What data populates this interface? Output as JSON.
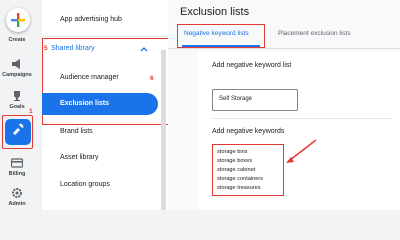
{
  "rail": {
    "create_label": "Create",
    "campaigns_label": "Campaigns",
    "goals_label": "Goals",
    "tools_label": "Tools",
    "billing_label": "Billing",
    "admin_label": "Admin"
  },
  "callouts": {
    "tools_step": "1",
    "shared_library_step": "5",
    "exclusion_lists_step": "6"
  },
  "nav": {
    "top_item": "App advertising hub",
    "shared_library": "Shared library",
    "items": [
      "Audience manager",
      "Exclusion lists",
      "Brand lists",
      "Asset library",
      "Location groups"
    ]
  },
  "page": {
    "title": "Exclusion lists",
    "tabs": [
      "Negative keyword lists",
      "Placement exclusion lists"
    ],
    "add_list_heading": "Add negative keyword list",
    "list_name_value": "Self Storage",
    "add_keywords_heading": "Add negative keywords",
    "keywords": [
      "storage bins",
      "storage boxes",
      "storage cabinet",
      "storage containers",
      "storage treasures"
    ]
  },
  "colors": {
    "accent": "#1a73e8",
    "highlight": "#e53935"
  }
}
